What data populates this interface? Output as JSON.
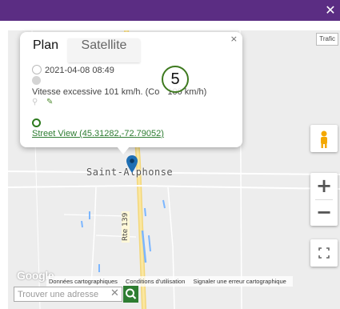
{
  "window": {
    "close_label": "✕"
  },
  "map": {
    "traffic_button": "Trafic",
    "town_label": "Saint-Alphonse",
    "road_label": "Rte 139",
    "google_logo": "Google",
    "attribution": {
      "map_data": "Données cartographiques",
      "terms": "Conditions d'utilisation",
      "report": "Signaler une erreur cartographique"
    },
    "zoom_in": "+",
    "zoom_out": "−",
    "colors": {
      "road": "#f6d35c",
      "water": "#7bb6ff",
      "accent": "#5b2d83",
      "green": "#2e7d32"
    }
  },
  "popup": {
    "close": "×",
    "tabs": {
      "plan": "Plan",
      "satellite": "Satellite"
    },
    "datetime": "2021-04-08 08:49",
    "event": "Vitesse excessive 101 km/h. (Co",
    "limit": "100 km/h)",
    "street_view_link": "Street View (45.31282,-72.79052)"
  },
  "badge": {
    "number": "5"
  },
  "search": {
    "placeholder": "Trouver une adresse",
    "clear": "✕"
  },
  "icons": [
    "close-icon",
    "clock-icon",
    "map-pin-icon",
    "pencil-icon",
    "street-view-icon",
    "pegman-icon",
    "fullscreen-icon",
    "search-icon",
    "location-marker-icon"
  ]
}
